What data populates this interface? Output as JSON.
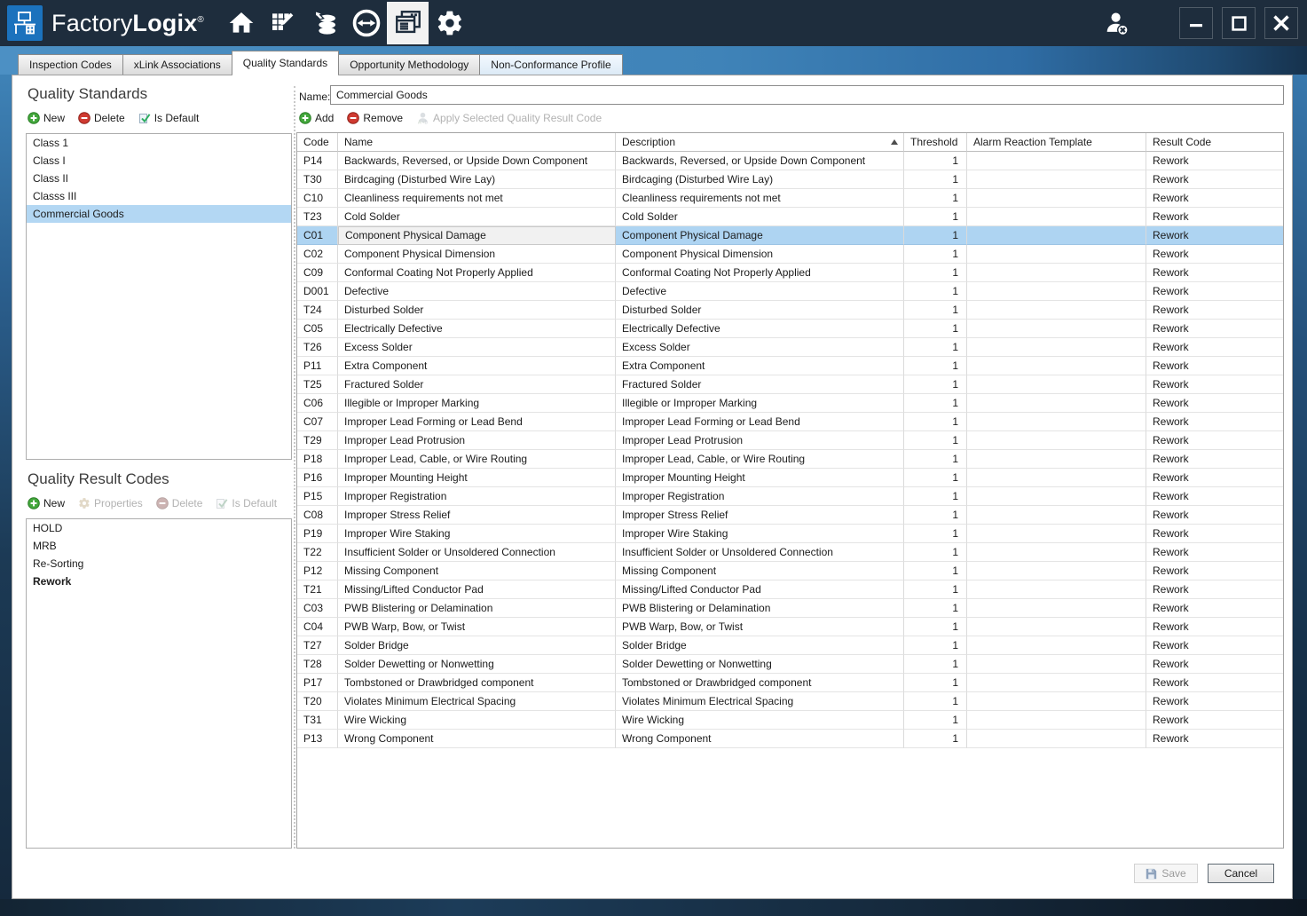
{
  "window": {
    "brand_first": "Factory",
    "brand_second": "Logix",
    "registered_mark": "®",
    "nav_icons": [
      "home",
      "design",
      "materials",
      "transfer",
      "documents",
      "settings"
    ],
    "active_nav": "documents"
  },
  "tabs": {
    "items": [
      "Inspection Codes",
      "xLink Associations",
      "Quality Standards",
      "Opportunity Methodology",
      "Non-Conformance Profile"
    ],
    "active": "Quality Standards"
  },
  "left": {
    "standards": {
      "title": "Quality Standards",
      "toolbar": {
        "new": "New",
        "delete": "Delete",
        "is_default": "Is Default"
      },
      "items": [
        "Class 1",
        "Class I",
        "Class II",
        "Classs III",
        "Commercial Goods"
      ],
      "selected_item": "Commercial Goods"
    },
    "result_codes": {
      "title": "Quality Result Codes",
      "toolbar": {
        "new": "New",
        "properties": "Properties",
        "delete": "Delete",
        "is_default": "Is Default"
      },
      "items": [
        "HOLD",
        "MRB",
        "Re-Sorting",
        "Rework"
      ],
      "default_item": "Rework"
    }
  },
  "main": {
    "name_label": "Name:",
    "name_value": "Commercial Goods",
    "toolbar": {
      "add": "Add",
      "remove": "Remove",
      "apply": "Apply Selected Quality Result Code"
    },
    "table": {
      "columns": [
        "Code",
        "Name",
        "Description",
        "Threshold",
        "Alarm Reaction Template",
        "Result Code"
      ],
      "sorted_column": "Description",
      "sort_direction": "asc",
      "selected_code": "C01",
      "rows": [
        {
          "code": "P14",
          "name": "Backwards, Reversed, or Upside Down Component",
          "description": "Backwards, Reversed, or Upside Down Component",
          "threshold": "1",
          "alarm": "",
          "result": "Rework"
        },
        {
          "code": "T30",
          "name": "Birdcaging (Disturbed Wire Lay)",
          "description": "Birdcaging (Disturbed Wire Lay)",
          "threshold": "1",
          "alarm": "",
          "result": "Rework"
        },
        {
          "code": "C10",
          "name": "Cleanliness requirements not met",
          "description": "Cleanliness requirements not met",
          "threshold": "1",
          "alarm": "",
          "result": "Rework"
        },
        {
          "code": "T23",
          "name": "Cold Solder",
          "description": "Cold Solder",
          "threshold": "1",
          "alarm": "",
          "result": "Rework"
        },
        {
          "code": "C01",
          "name": "Component Physical Damage",
          "description": "Component Physical Damage",
          "threshold": "1",
          "alarm": "",
          "result": "Rework"
        },
        {
          "code": "C02",
          "name": "Component Physical Dimension",
          "description": "Component Physical Dimension",
          "threshold": "1",
          "alarm": "",
          "result": "Rework"
        },
        {
          "code": "C09",
          "name": "Conformal Coating Not Properly Applied",
          "description": "Conformal Coating Not Properly Applied",
          "threshold": "1",
          "alarm": "",
          "result": "Rework"
        },
        {
          "code": "D001",
          "name": "Defective",
          "description": "Defective",
          "threshold": "1",
          "alarm": "",
          "result": "Rework"
        },
        {
          "code": "T24",
          "name": "Disturbed Solder",
          "description": "Disturbed Solder",
          "threshold": "1",
          "alarm": "",
          "result": "Rework"
        },
        {
          "code": "C05",
          "name": "Electrically Defective",
          "description": "Electrically Defective",
          "threshold": "1",
          "alarm": "",
          "result": "Rework"
        },
        {
          "code": "T26",
          "name": "Excess Solder",
          "description": "Excess Solder",
          "threshold": "1",
          "alarm": "",
          "result": "Rework"
        },
        {
          "code": "P11",
          "name": "Extra Component",
          "description": "Extra Component",
          "threshold": "1",
          "alarm": "",
          "result": "Rework"
        },
        {
          "code": "T25",
          "name": "Fractured Solder",
          "description": "Fractured Solder",
          "threshold": "1",
          "alarm": "",
          "result": "Rework"
        },
        {
          "code": "C06",
          "name": "Illegible or Improper Marking",
          "description": "Illegible or Improper Marking",
          "threshold": "1",
          "alarm": "",
          "result": "Rework"
        },
        {
          "code": "C07",
          "name": "Improper Lead Forming or Lead Bend",
          "description": "Improper Lead Forming or Lead Bend",
          "threshold": "1",
          "alarm": "",
          "result": "Rework"
        },
        {
          "code": "T29",
          "name": "Improper Lead Protrusion",
          "description": "Improper Lead Protrusion",
          "threshold": "1",
          "alarm": "",
          "result": "Rework"
        },
        {
          "code": "P18",
          "name": "Improper Lead, Cable, or Wire Routing",
          "description": "Improper Lead, Cable, or Wire Routing",
          "threshold": "1",
          "alarm": "",
          "result": "Rework"
        },
        {
          "code": "P16",
          "name": "Improper Mounting Height",
          "description": "Improper Mounting Height",
          "threshold": "1",
          "alarm": "",
          "result": "Rework"
        },
        {
          "code": "P15",
          "name": "Improper Registration",
          "description": "Improper Registration",
          "threshold": "1",
          "alarm": "",
          "result": "Rework"
        },
        {
          "code": "C08",
          "name": "Improper Stress Relief",
          "description": "Improper Stress Relief",
          "threshold": "1",
          "alarm": "",
          "result": "Rework"
        },
        {
          "code": "P19",
          "name": "Improper Wire Staking",
          "description": "Improper Wire Staking",
          "threshold": "1",
          "alarm": "",
          "result": "Rework"
        },
        {
          "code": "T22",
          "name": "Insufficient Solder or Unsoldered Connection",
          "description": "Insufficient Solder or Unsoldered Connection",
          "threshold": "1",
          "alarm": "",
          "result": "Rework"
        },
        {
          "code": "P12",
          "name": "Missing Component",
          "description": "Missing Component",
          "threshold": "1",
          "alarm": "",
          "result": "Rework"
        },
        {
          "code": "T21",
          "name": "Missing/Lifted Conductor Pad",
          "description": "Missing/Lifted Conductor Pad",
          "threshold": "1",
          "alarm": "",
          "result": "Rework"
        },
        {
          "code": "C03",
          "name": "PWB Blistering or Delamination",
          "description": "PWB Blistering or Delamination",
          "threshold": "1",
          "alarm": "",
          "result": "Rework"
        },
        {
          "code": "C04",
          "name": "PWB Warp, Bow, or Twist",
          "description": "PWB Warp, Bow, or Twist",
          "threshold": "1",
          "alarm": "",
          "result": "Rework"
        },
        {
          "code": "T27",
          "name": "Solder Bridge",
          "description": "Solder Bridge",
          "threshold": "1",
          "alarm": "",
          "result": "Rework"
        },
        {
          "code": "T28",
          "name": "Solder Dewetting or Nonwetting",
          "description": "Solder Dewetting or Nonwetting",
          "threshold": "1",
          "alarm": "",
          "result": "Rework"
        },
        {
          "code": "P17",
          "name": "Tombstoned or Drawbridged component",
          "description": "Tombstoned or Drawbridged component",
          "threshold": "1",
          "alarm": "",
          "result": "Rework"
        },
        {
          "code": "T20",
          "name": "Violates Minimum Electrical Spacing",
          "description": "Violates Minimum Electrical Spacing",
          "threshold": "1",
          "alarm": "",
          "result": "Rework"
        },
        {
          "code": "T31",
          "name": "Wire Wicking",
          "description": "Wire Wicking",
          "threshold": "1",
          "alarm": "",
          "result": "Rework"
        },
        {
          "code": "P13",
          "name": "Wrong Component",
          "description": "Wrong Component",
          "threshold": "1",
          "alarm": "",
          "result": "Rework"
        }
      ]
    }
  },
  "footer": {
    "save": "Save",
    "cancel": "Cancel"
  },
  "colors": {
    "accent_blue": "#1b72bd",
    "selection_blue": "#aed4f2",
    "titlebar": "#1e2d3d"
  }
}
